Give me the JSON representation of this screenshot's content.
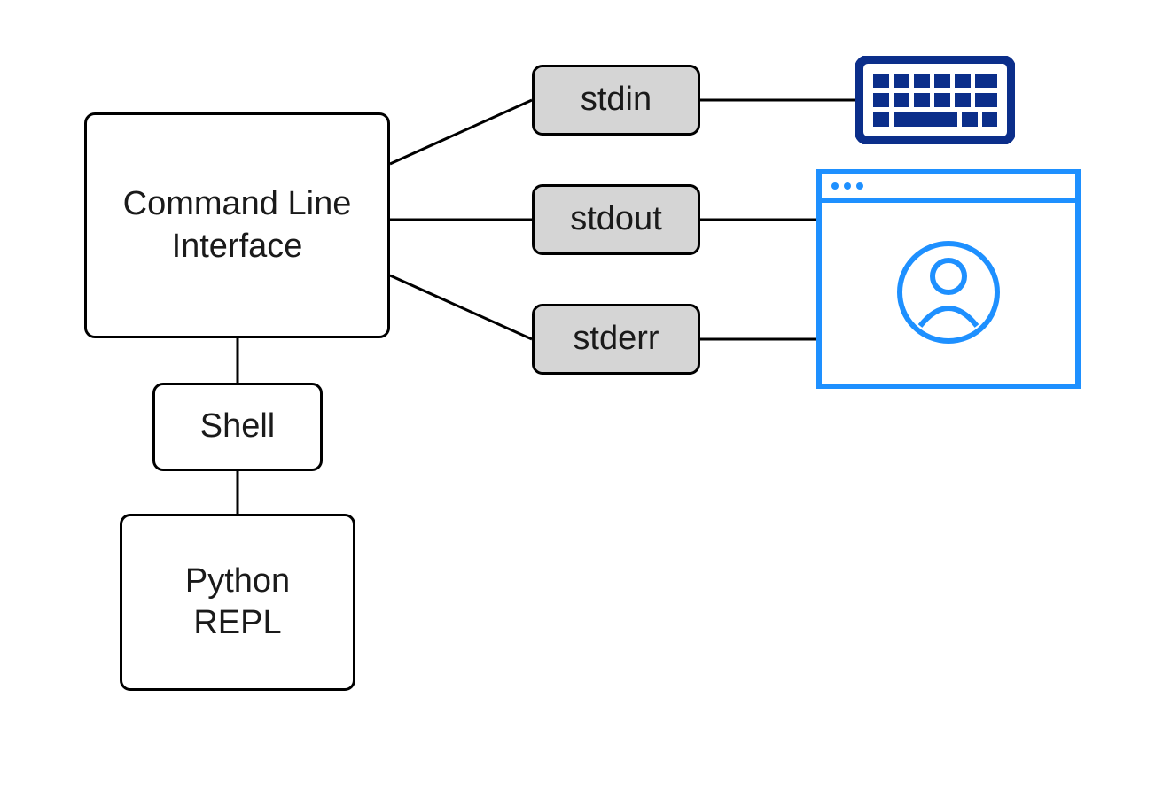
{
  "nodes": {
    "cli": {
      "label": "Command Line\nInterface"
    },
    "shell": {
      "label": "Shell"
    },
    "repl": {
      "label": "Python\nREPL"
    },
    "stdin": {
      "label": "stdin"
    },
    "stdout": {
      "label": "stdout"
    },
    "stderr": {
      "label": "stderr"
    }
  },
  "icons": {
    "keyboard": "keyboard-icon",
    "terminal": "terminal-user-icon"
  },
  "colors": {
    "keyboard": "#0b2e8a",
    "terminal": "#1e90ff",
    "node_border": "#000000",
    "node_grey": "#d5d5d5"
  },
  "edges": [
    [
      "cli",
      "stdin"
    ],
    [
      "cli",
      "stdout"
    ],
    [
      "cli",
      "stderr"
    ],
    [
      "cli",
      "shell"
    ],
    [
      "shell",
      "repl"
    ],
    [
      "stdin",
      "keyboard"
    ],
    [
      "stdout",
      "terminal"
    ],
    [
      "stderr",
      "terminal"
    ]
  ]
}
